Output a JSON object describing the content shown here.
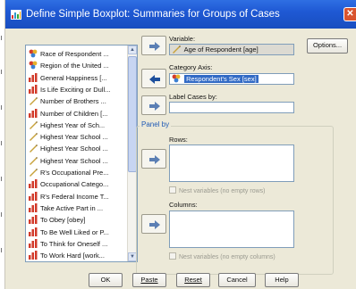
{
  "window": {
    "title": "Define Simple Boxplot: Summaries for Groups of Cases"
  },
  "variable_list": {
    "items": [
      {
        "label": "Race of Respondent ...",
        "icon": "nominal-icon"
      },
      {
        "label": "Region of the United ...",
        "icon": "nominal-icon"
      },
      {
        "label": "General Happiness [...",
        "icon": "ordinal-icon"
      },
      {
        "label": "Is Life Exciting or Dull...",
        "icon": "ordinal-icon"
      },
      {
        "label": "Number of Brothers ...",
        "icon": "scale-icon"
      },
      {
        "label": "Number of Children [...",
        "icon": "ordinal-icon"
      },
      {
        "label": "Highest Year of Sch...",
        "icon": "scale-icon"
      },
      {
        "label": "Highest Year School ...",
        "icon": "scale-icon"
      },
      {
        "label": "Highest Year School ...",
        "icon": "scale-icon"
      },
      {
        "label": "Highest Year School ...",
        "icon": "scale-icon"
      },
      {
        "label": "R's Occupational Pre...",
        "icon": "scale-icon"
      },
      {
        "label": "Occupational Catego...",
        "icon": "ordinal-icon"
      },
      {
        "label": "R's Federal Income T...",
        "icon": "ordinal-icon"
      },
      {
        "label": "Take Active Part in ...",
        "icon": "ordinal-icon"
      },
      {
        "label": "To Obey [obey]",
        "icon": "ordinal-icon"
      },
      {
        "label": "To Be Well Liked or P...",
        "icon": "ordinal-icon"
      },
      {
        "label": "To Think for Oneself ...",
        "icon": "ordinal-icon"
      },
      {
        "label": "To Work Hard [work...",
        "icon": "ordinal-icon"
      }
    ]
  },
  "variable": {
    "label": "Variable:",
    "value": "Age of Respondent [age]"
  },
  "category_axis": {
    "label": "Category Axis:",
    "value": "Respondent's Sex [sex]"
  },
  "label_cases": {
    "label": "Label Cases by:",
    "value": ""
  },
  "panel_by": {
    "title": "Panel by",
    "rows_label": "Rows:",
    "rows_nest": "Nest variables (no empty rows)",
    "columns_label": "Columns:",
    "columns_nest": "Nest variables (no empty columns)"
  },
  "buttons": {
    "options": "Options...",
    "ok": "OK",
    "paste": "Paste",
    "reset": "Reset",
    "cancel": "Cancel",
    "help": "Help"
  },
  "colors": {
    "title_bar": "#1f59d4",
    "selected": "#316ac5",
    "panel_title": "#1f5ab5"
  }
}
